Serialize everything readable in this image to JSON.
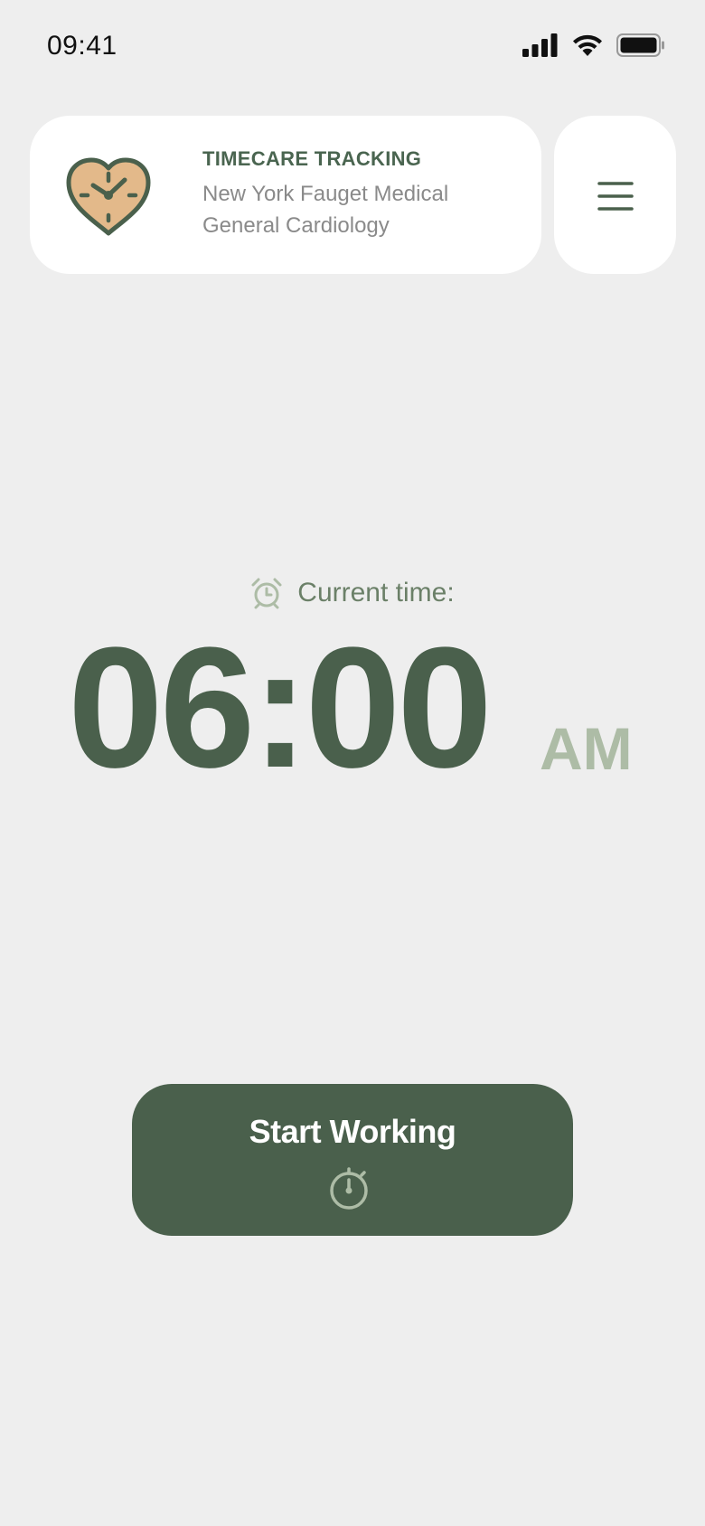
{
  "status_bar": {
    "time": "09:41",
    "icons": [
      "signal-icon",
      "wifi-icon",
      "battery-icon"
    ]
  },
  "header": {
    "logo_icon": "heart-clock-icon",
    "brand_title": "TIMECARE TRACKING",
    "org_line1": "New York Fauget Medical",
    "org_line2": "General Cardiology",
    "menu_icon": "hamburger-menu-icon"
  },
  "clock": {
    "label": "Current time:",
    "label_icon": "alarm-clock-icon",
    "time": "06:00",
    "period": "AM"
  },
  "action": {
    "start_label": "Start Working",
    "start_icon": "stopwatch-icon"
  },
  "colors": {
    "background": "#eeeeee",
    "primary_green": "#4a604c",
    "muted_green": "#adbca6",
    "logo_fill": "#e3b98a",
    "card": "#ffffff",
    "secondary_text": "#8a8a8a"
  }
}
